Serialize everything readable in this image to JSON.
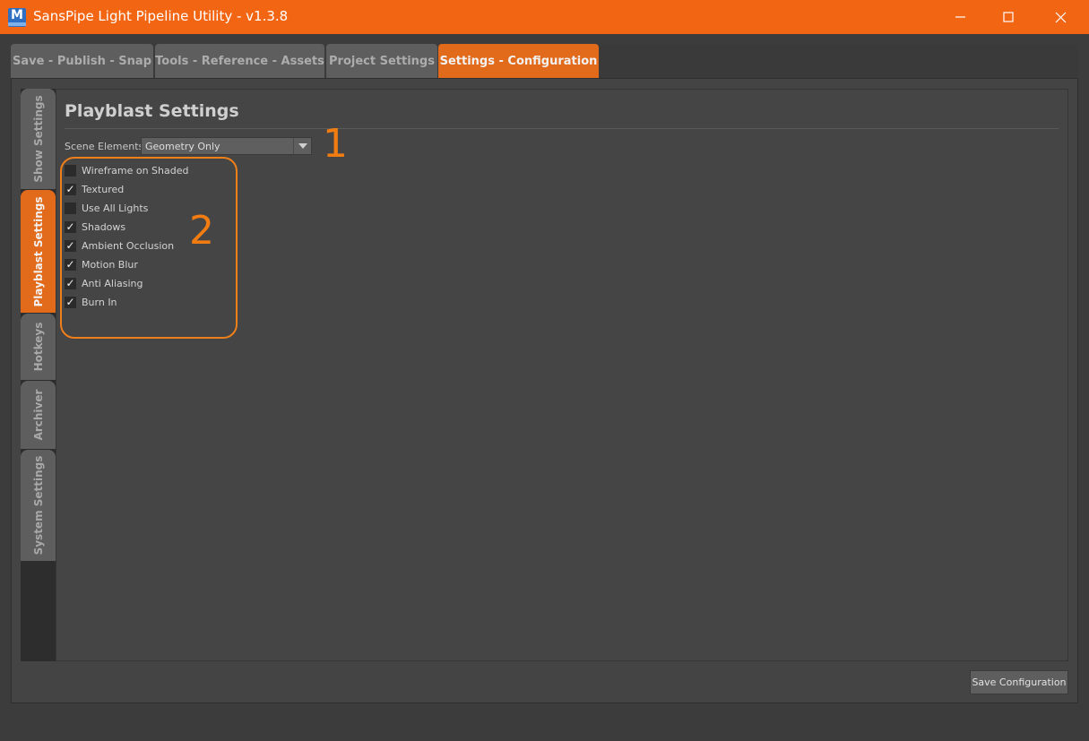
{
  "window": {
    "title": "SansPipe Light Pipeline Utility - v1.3.8",
    "app_icon_letter": "M"
  },
  "top_tabs": [
    {
      "label": "Save - Publish - Snap",
      "active": false
    },
    {
      "label": "Tools - Reference - Assets",
      "active": false
    },
    {
      "label": "Project Settings",
      "active": false
    },
    {
      "label": "Settings - Configuration",
      "active": true
    }
  ],
  "side_tabs": [
    {
      "label": "Show Settings",
      "active": false
    },
    {
      "label": "Playblast Settings",
      "active": true
    },
    {
      "label": "Hotkeys",
      "active": false
    },
    {
      "label": "Archiver",
      "active": false
    },
    {
      "label": "System Settings",
      "active": false
    }
  ],
  "section": {
    "title": "Playblast Settings",
    "scene_elements_label": "Scene Elements",
    "scene_elements_value": "Geometry Only"
  },
  "checkboxes": [
    {
      "label": "Wireframe on Shaded",
      "checked": false
    },
    {
      "label": "Textured",
      "checked": true
    },
    {
      "label": "Use All Lights",
      "checked": false
    },
    {
      "label": "Shadows",
      "checked": true
    },
    {
      "label": "Ambient Occlusion",
      "checked": true
    },
    {
      "label": "Motion Blur",
      "checked": true
    },
    {
      "label": "Anti Aliasing",
      "checked": true
    },
    {
      "label": "Burn In",
      "checked": true
    }
  ],
  "annotations": {
    "one": "1",
    "two": "2"
  },
  "footer": {
    "save_label": "Save Configuration"
  },
  "colors": {
    "accent": "#f26513",
    "active_tab": "#e26a1b",
    "annotation": "#ef7f1a"
  }
}
